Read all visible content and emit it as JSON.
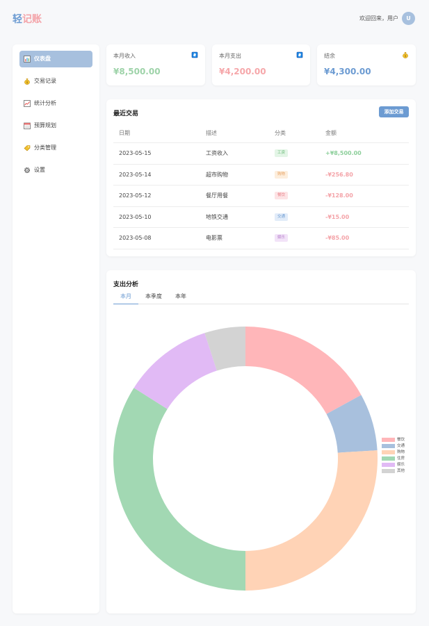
{
  "header": {
    "logo_part1": "轻",
    "logo_part2": "记账",
    "welcome": "欢迎回来，用户",
    "avatar_initial": "U"
  },
  "sidebar": {
    "items": [
      {
        "label": "仪表盘",
        "icon": "chart-icon",
        "active": true
      },
      {
        "label": "交易记录",
        "icon": "money-bag-icon",
        "active": false
      },
      {
        "label": "统计分析",
        "icon": "trend-chart-icon",
        "active": false
      },
      {
        "label": "预算规划",
        "icon": "calendar-icon",
        "active": false
      },
      {
        "label": "分类管理",
        "icon": "tag-icon",
        "active": false
      },
      {
        "label": "设置",
        "icon": "gear-icon",
        "active": false
      }
    ]
  },
  "stats": {
    "income": {
      "title": "本月收入",
      "value": "¥8,500.00",
      "color": "#9ed3a9",
      "icon": "card-icon"
    },
    "expense": {
      "title": "本月支出",
      "value": "¥4,200.00",
      "color": "#f6a7aa",
      "icon": "card-icon"
    },
    "balance": {
      "title": "结余",
      "value": "¥4,300.00",
      "color": "#6c9bd2",
      "icon": "money-bag-icon"
    }
  },
  "recent": {
    "title": "最近交易",
    "add_label": "添加交易",
    "columns": [
      "日期",
      "描述",
      "分类",
      "金额"
    ],
    "rows": [
      {
        "date": "2023-05-15",
        "desc": "工资收入",
        "category": "工资",
        "amount": "+¥8,500.00",
        "badge_bg": "#e3f5e6",
        "badge_fg": "#6dbb7b",
        "amount_color": "#8dcf9b"
      },
      {
        "date": "2023-05-14",
        "desc": "超市购物",
        "category": "购物",
        "amount": "-¥256.80",
        "badge_bg": "#fdeedd",
        "badge_fg": "#e8a365",
        "amount_color": "#f4a3a8"
      },
      {
        "date": "2023-05-12",
        "desc": "餐厅用餐",
        "category": "餐饮",
        "amount": "-¥128.00",
        "badge_bg": "#fde3e5",
        "badge_fg": "#e8838a",
        "amount_color": "#f4a3a8"
      },
      {
        "date": "2023-05-10",
        "desc": "地铁交通",
        "category": "交通",
        "amount": "-¥15.00",
        "badge_bg": "#e2ecf9",
        "badge_fg": "#6c9bd2",
        "amount_color": "#f4a3a8"
      },
      {
        "date": "2023-05-08",
        "desc": "电影票",
        "category": "娱乐",
        "amount": "-¥85.00",
        "badge_bg": "#f2e3f8",
        "badge_fg": "#b37ac8",
        "amount_color": "#f4a3a8"
      }
    ]
  },
  "analysis": {
    "title": "支出分析",
    "tabs": [
      {
        "label": "本月",
        "active": true
      },
      {
        "label": "本季度",
        "active": false
      },
      {
        "label": "本年",
        "active": false
      }
    ]
  },
  "chart_data": {
    "type": "pie",
    "variant": "doughnut",
    "legend_position": "right",
    "categories": [
      "餐饮",
      "交通",
      "购物",
      "住房",
      "娱乐",
      "其他"
    ],
    "values": [
      17,
      7,
      26,
      34,
      11,
      5
    ],
    "colors": [
      "#ffb6b9",
      "#a8c0dd",
      "#ffd3b6",
      "#a2d8b3",
      "#e1baf5",
      "#d3d3d3"
    ]
  }
}
